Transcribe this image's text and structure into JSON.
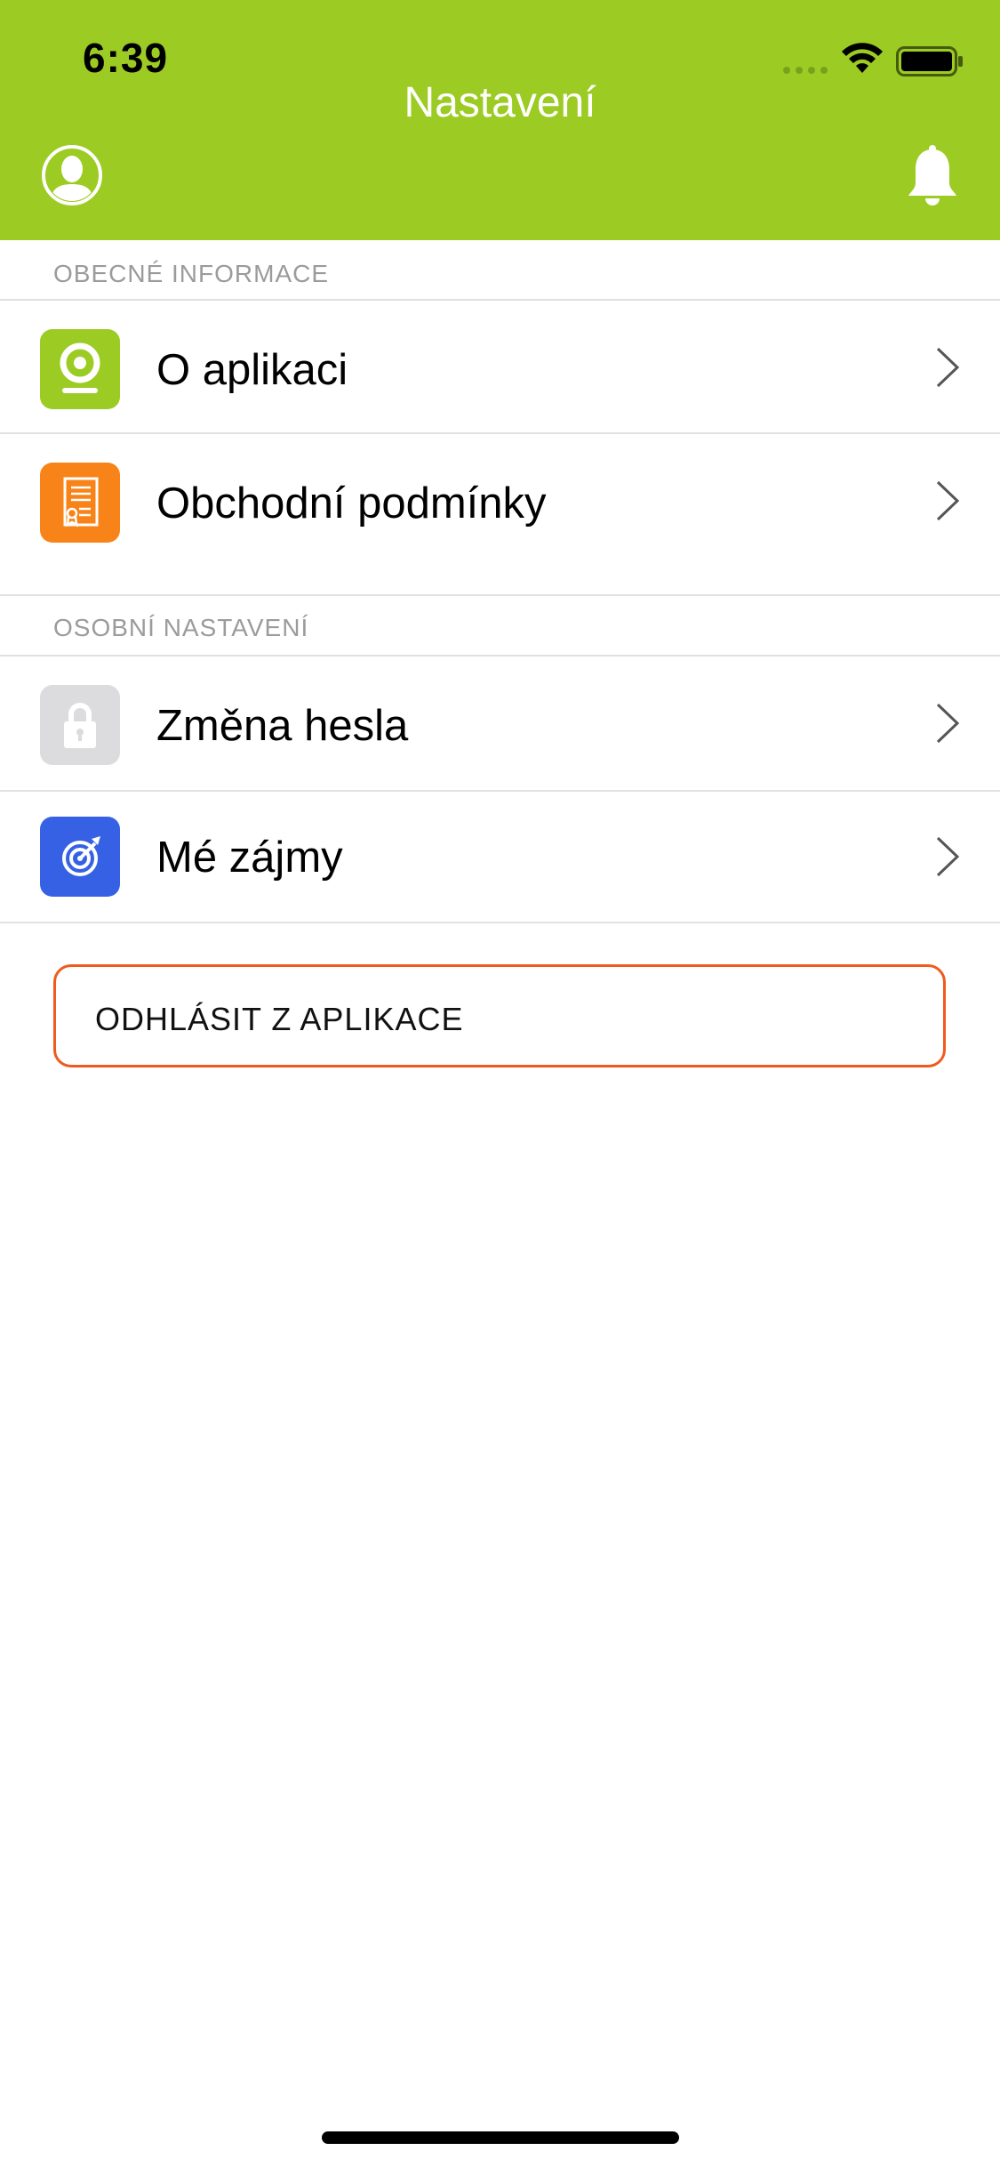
{
  "status_bar": {
    "time": "6:39"
  },
  "header": {
    "title": "Nastavení",
    "left_icon": "profile-icon",
    "right_icon": "bell-icon",
    "background_color": "#9ccb23"
  },
  "sections": [
    {
      "title": "OBECNÉ INFORMACE",
      "items": [
        {
          "label": "O aplikaci",
          "icon": "app-info-icon",
          "icon_color": "#9ccb23"
        },
        {
          "label": "Obchodní podmínky",
          "icon": "certificate-document-icon",
          "icon_color": "#f88419"
        }
      ]
    },
    {
      "title": "OSOBNÍ NASTAVENÍ",
      "items": [
        {
          "label": "Změna hesla",
          "icon": "lock-icon",
          "icon_color": "#dcdcdf"
        },
        {
          "label": "Mé zájmy",
          "icon": "target-icon",
          "icon_color": "#3761e4"
        }
      ]
    }
  ],
  "logout": {
    "label": "ODHLÁSIT Z APLIKACE",
    "border_color": "#f05a1e"
  }
}
